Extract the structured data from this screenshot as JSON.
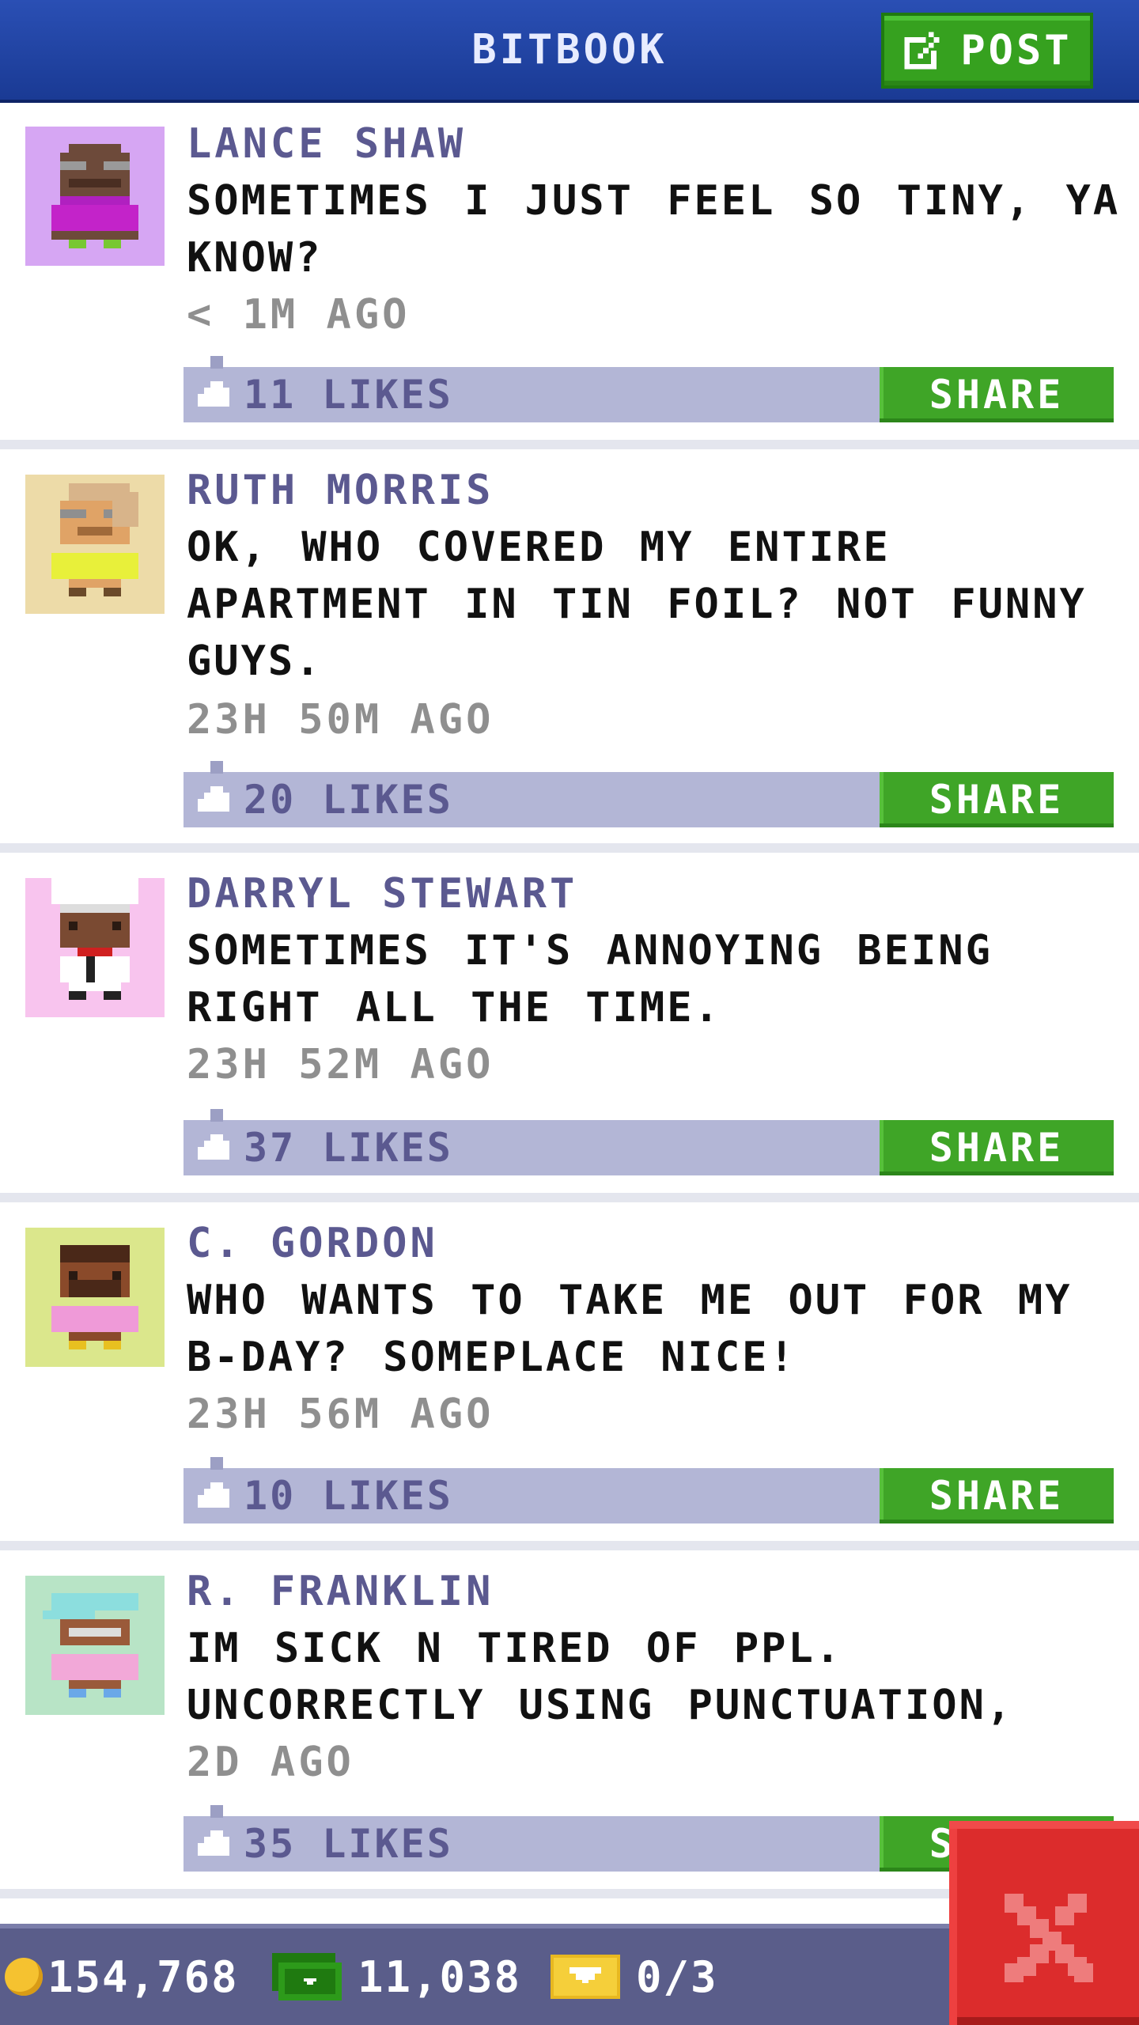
{
  "header": {
    "title": "BITBOOK",
    "post_label": "POST",
    "post_icon": "compose-icon"
  },
  "posts": [
    {
      "author": "LANCE SHAW",
      "message": "SOMETIMES I JUST FEEL SO TINY, YA KNOW?",
      "time": "< 1M AGO",
      "likes": "11 LIKES",
      "share": "SHARE",
      "avatar_bg": "#d6a6f3"
    },
    {
      "author": "RUTH MORRIS",
      "message": "OK, WHO COVERED MY ENTIRE APARTMENT IN TIN FOIL? NOT FUNNY GUYS.",
      "time": "23H 50M AGO",
      "likes": "20 LIKES",
      "share": "SHARE",
      "avatar_bg": "#eddba8"
    },
    {
      "author": "DARRYL STEWART",
      "message": "SOMETIMES IT'S ANNOYING BEING RIGHT ALL THE TIME.",
      "time": "23H 52M AGO",
      "likes": "37 LIKES",
      "share": "SHARE",
      "avatar_bg": "#f8c4ee"
    },
    {
      "author": "C. GORDON",
      "message": "WHO WANTS TO TAKE ME OUT FOR MY B-DAY? SOMEPLACE NICE!",
      "time": "23H 56M AGO",
      "likes": "10 LIKES",
      "share": "SHARE",
      "avatar_bg": "#dbe78c"
    },
    {
      "author": "R. FRANKLIN",
      "message": "IM SICK N TIRED OF PPL. UNCORRECTLY USING PUNCTUATION,",
      "time": "2D AGO",
      "likes": "35 LIKES",
      "share": "SHARE",
      "avatar_bg": "#b8e4c6"
    }
  ],
  "footer": {
    "coins": "154,768",
    "bux": "11,038",
    "vip": "0/3",
    "coin_icon": "coin-icon",
    "bux_icon": "bux-icon",
    "vip_icon": "vip-ticket-icon"
  },
  "close_icon": "close-icon",
  "colors": {
    "header": "#1f43a8",
    "accent_green": "#3fa527",
    "like_bar": "#b3b6d6",
    "author_text": "#5b5990",
    "close": "#dc2c2c",
    "footer": "#5a5d8a"
  }
}
